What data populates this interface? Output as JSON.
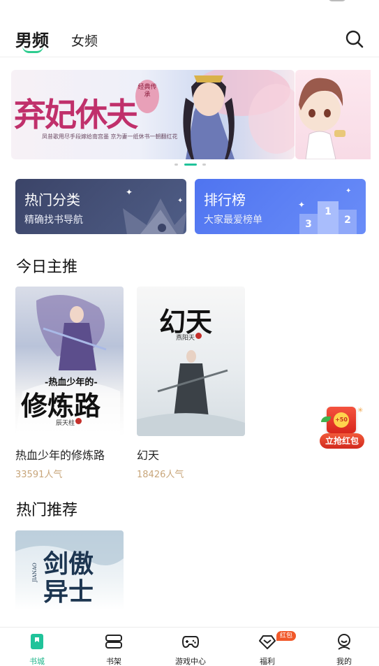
{
  "top_nav": {
    "tab_male": "男频",
    "tab_female": "女频",
    "search_icon": "search-icon"
  },
  "banner": {
    "title": "弃妃休夫",
    "seal": "经典传承",
    "subtitle": "凤昔歌用尽手段嫁给南宫墨 京为妻一纸休书一朝翻红花",
    "slide_count": 3,
    "active_slide": 2
  },
  "categories": [
    {
      "title": "热门分类",
      "subtitle": "精确找书导航",
      "color": "#3b4468",
      "icon": "crown-icon"
    },
    {
      "title": "排行榜",
      "subtitle": "大家最爱榜单",
      "color": "#5479f3",
      "icon": "podium-icon",
      "podium": [
        "3",
        "1",
        "2"
      ]
    }
  ],
  "today_pick": {
    "heading": "今日主推",
    "books": [
      {
        "name": "热血少年的修炼路",
        "popularity": "33591人气",
        "cover_title_top": "-热血少年的-",
        "cover_title_main": "修炼路",
        "cover_author": "辰天柱"
      },
      {
        "name": "幻天",
        "popularity": "18426人气",
        "cover_title_main": "幻天",
        "cover_author": "燕阳天"
      }
    ]
  },
  "hot_recommend": {
    "heading": "热门推荐",
    "books": [
      {
        "cover_title_main": "剑傲异士",
        "cover_pinyin": "JIANAO"
      }
    ]
  },
  "float_packet": {
    "amount": "+50",
    "label": "立抢红包"
  },
  "bottom_nav": {
    "items": [
      {
        "label": "书城",
        "icon": "bookstore-icon",
        "active": true
      },
      {
        "label": "书架",
        "icon": "bookshelf-icon",
        "active": false
      },
      {
        "label": "游戏中心",
        "icon": "gamepad-icon",
        "active": false
      },
      {
        "label": "福利",
        "icon": "gift-icon",
        "active": false,
        "badge": "红包"
      },
      {
        "label": "我的",
        "icon": "profile-icon",
        "active": false
      }
    ]
  },
  "colors": {
    "accent": "#20c39a",
    "popularity": "#c8a67b",
    "banner_title": "#c0306b",
    "badge": "#f1592a"
  }
}
